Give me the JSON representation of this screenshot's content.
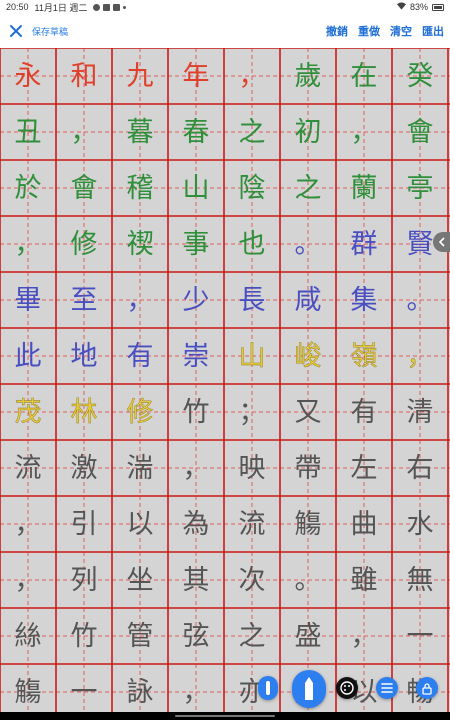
{
  "status_bar": {
    "time": "20:50",
    "date": "11月1日 週二",
    "battery": "83%"
  },
  "toolbar": {
    "close_icon": "close-icon",
    "save_draft": "保存草稿",
    "undo": "撤銷",
    "redo": "重做",
    "clear": "清空",
    "export": "匯出"
  },
  "colors": {
    "accent": "#1f6fd6",
    "grid_border": "#cc1a1a",
    "grid_dash": "#e26060",
    "paper": "#d4d4d4",
    "red": "#e0402a",
    "green": "#2f8f3a",
    "blue": "#4a4fc0",
    "yellow": "#e6c93a",
    "gray": "#555555"
  },
  "grid": {
    "columns": 8,
    "rows": [
      [
        {
          "ch": "永",
          "c": "red"
        },
        {
          "ch": "和",
          "c": "red"
        },
        {
          "ch": "九",
          "c": "red"
        },
        {
          "ch": "年",
          "c": "red"
        },
        {
          "ch": "，",
          "c": "red"
        },
        {
          "ch": "歲",
          "c": "green"
        },
        {
          "ch": "在",
          "c": "green"
        },
        {
          "ch": "癸",
          "c": "green"
        }
      ],
      [
        {
          "ch": "丑",
          "c": "green"
        },
        {
          "ch": "，",
          "c": "green"
        },
        {
          "ch": "暮",
          "c": "green"
        },
        {
          "ch": "春",
          "c": "green"
        },
        {
          "ch": "之",
          "c": "green"
        },
        {
          "ch": "初",
          "c": "green"
        },
        {
          "ch": "，",
          "c": "green"
        },
        {
          "ch": "會",
          "c": "green"
        }
      ],
      [
        {
          "ch": "於",
          "c": "green"
        },
        {
          "ch": "會",
          "c": "green"
        },
        {
          "ch": "稽",
          "c": "green"
        },
        {
          "ch": "山",
          "c": "green"
        },
        {
          "ch": "陰",
          "c": "green"
        },
        {
          "ch": "之",
          "c": "green"
        },
        {
          "ch": "蘭",
          "c": "green"
        },
        {
          "ch": "亭",
          "c": "green"
        }
      ],
      [
        {
          "ch": "，",
          "c": "green"
        },
        {
          "ch": "修",
          "c": "green"
        },
        {
          "ch": "禊",
          "c": "green"
        },
        {
          "ch": "事",
          "c": "green"
        },
        {
          "ch": "也",
          "c": "green"
        },
        {
          "ch": "。",
          "c": "blue"
        },
        {
          "ch": "群",
          "c": "blue"
        },
        {
          "ch": "賢",
          "c": "blue"
        }
      ],
      [
        {
          "ch": "畢",
          "c": "blue"
        },
        {
          "ch": "至",
          "c": "blue"
        },
        {
          "ch": "，",
          "c": "blue"
        },
        {
          "ch": "少",
          "c": "blue"
        },
        {
          "ch": "長",
          "c": "blue"
        },
        {
          "ch": "咸",
          "c": "blue"
        },
        {
          "ch": "集",
          "c": "blue"
        },
        {
          "ch": "。",
          "c": "blue"
        }
      ],
      [
        {
          "ch": "此",
          "c": "blue"
        },
        {
          "ch": "地",
          "c": "blue"
        },
        {
          "ch": "有",
          "c": "blue"
        },
        {
          "ch": "崇",
          "c": "blue"
        },
        {
          "ch": "山",
          "c": "yellow"
        },
        {
          "ch": "峻",
          "c": "yellow"
        },
        {
          "ch": "嶺",
          "c": "yellow"
        },
        {
          "ch": "，",
          "c": "yellow"
        }
      ],
      [
        {
          "ch": "茂",
          "c": "yellow"
        },
        {
          "ch": "林",
          "c": "yellow"
        },
        {
          "ch": "修",
          "c": "yellow"
        },
        {
          "ch": "竹",
          "c": "gray"
        },
        {
          "ch": "；",
          "c": "gray"
        },
        {
          "ch": "又",
          "c": "gray"
        },
        {
          "ch": "有",
          "c": "gray"
        },
        {
          "ch": "清",
          "c": "gray"
        }
      ],
      [
        {
          "ch": "流",
          "c": "gray"
        },
        {
          "ch": "激",
          "c": "gray"
        },
        {
          "ch": "湍",
          "c": "gray"
        },
        {
          "ch": "，",
          "c": "gray"
        },
        {
          "ch": "映",
          "c": "gray"
        },
        {
          "ch": "帶",
          "c": "gray"
        },
        {
          "ch": "左",
          "c": "gray"
        },
        {
          "ch": "右",
          "c": "gray"
        }
      ],
      [
        {
          "ch": "，",
          "c": "gray"
        },
        {
          "ch": "引",
          "c": "gray"
        },
        {
          "ch": "以",
          "c": "gray"
        },
        {
          "ch": "為",
          "c": "gray"
        },
        {
          "ch": "流",
          "c": "gray"
        },
        {
          "ch": "觴",
          "c": "gray"
        },
        {
          "ch": "曲",
          "c": "gray"
        },
        {
          "ch": "水",
          "c": "gray"
        }
      ],
      [
        {
          "ch": "，",
          "c": "gray"
        },
        {
          "ch": "列",
          "c": "gray"
        },
        {
          "ch": "坐",
          "c": "gray"
        },
        {
          "ch": "其",
          "c": "gray"
        },
        {
          "ch": "次",
          "c": "gray"
        },
        {
          "ch": "。",
          "c": "gray"
        },
        {
          "ch": "雖",
          "c": "gray"
        },
        {
          "ch": "無",
          "c": "gray"
        }
      ],
      [
        {
          "ch": "絲",
          "c": "gray"
        },
        {
          "ch": "竹",
          "c": "gray"
        },
        {
          "ch": "管",
          "c": "gray"
        },
        {
          "ch": "弦",
          "c": "gray"
        },
        {
          "ch": "之",
          "c": "gray"
        },
        {
          "ch": "盛",
          "c": "gray"
        },
        {
          "ch": "，",
          "c": "gray"
        },
        {
          "ch": "一",
          "c": "gray"
        }
      ],
      [
        {
          "ch": "觴",
          "c": "gray"
        },
        {
          "ch": "一",
          "c": "gray"
        },
        {
          "ch": "詠",
          "c": "gray"
        },
        {
          "ch": "，",
          "c": "gray"
        },
        {
          "ch": "亦",
          "c": "gray"
        },
        {
          "ch": "足",
          "c": "gray"
        },
        {
          "ch": "以",
          "c": "gray"
        },
        {
          "ch": "暢",
          "c": "gray"
        }
      ]
    ]
  },
  "floating_buttons": [
    {
      "name": "brush-thin-icon"
    },
    {
      "name": "brush-thick-icon"
    },
    {
      "name": "palette-icon"
    },
    {
      "name": "menu-icon"
    },
    {
      "name": "lock-icon"
    }
  ]
}
